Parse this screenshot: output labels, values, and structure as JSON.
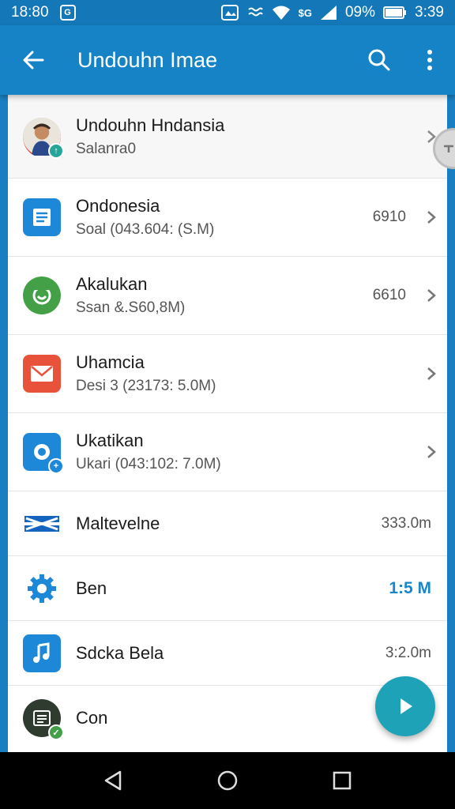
{
  "status_bar": {
    "time": "18:80",
    "badge_text": "G",
    "battery_percent": "09%",
    "clock_right": "3:39",
    "network_label": "$G"
  },
  "app_bar": {
    "title": "Undouhn Imae",
    "icons": [
      "back-arrow-icon",
      "search-icon",
      "overflow-menu-icon"
    ]
  },
  "list": {
    "header": {
      "title": "Undouhn Hndansia",
      "subtitle": "Salanra0"
    },
    "rows": [
      {
        "title": "Ondonesia",
        "subtitle": "Soal (043.604: (S.M)",
        "meta": "6910",
        "icon": "document-icon",
        "color": "#1e88d8"
      },
      {
        "title": "Akalukan",
        "subtitle": "Ssan &.S60,8M)",
        "meta": "6610",
        "icon": "face-icon",
        "color": "#43a047"
      },
      {
        "title": "Uhamcia",
        "subtitle": "Desi 3 (23173: 5.0M)",
        "meta": "",
        "icon": "mail-icon",
        "color": "#e8523a"
      },
      {
        "title": "Ukatikan",
        "subtitle": "Ukari (043:102: 7.0M)",
        "meta": "",
        "icon": "camera-icon",
        "color": "#1e88d8"
      },
      {
        "title": "Maltevelne",
        "meta": "333.0m",
        "icon": "flag-icon",
        "color": "#1565c0"
      },
      {
        "title": "Ben",
        "meta": "1:5 M",
        "icon": "gear-icon",
        "color": "#1e88d8"
      },
      {
        "title": "Sdcka Bela",
        "meta": "3:2.0m",
        "icon": "music-icon",
        "color": "#1e88d8"
      },
      {
        "title": "Con",
        "meta": "",
        "icon": "contact-icon",
        "color": "#2e3b2e"
      }
    ]
  },
  "colors": {
    "primary": "#1683c6",
    "accent": "#1ea2b8",
    "status": "#1478b8"
  },
  "nav": [
    "back-triangle-icon",
    "home-circle-icon",
    "recents-square-icon"
  ]
}
